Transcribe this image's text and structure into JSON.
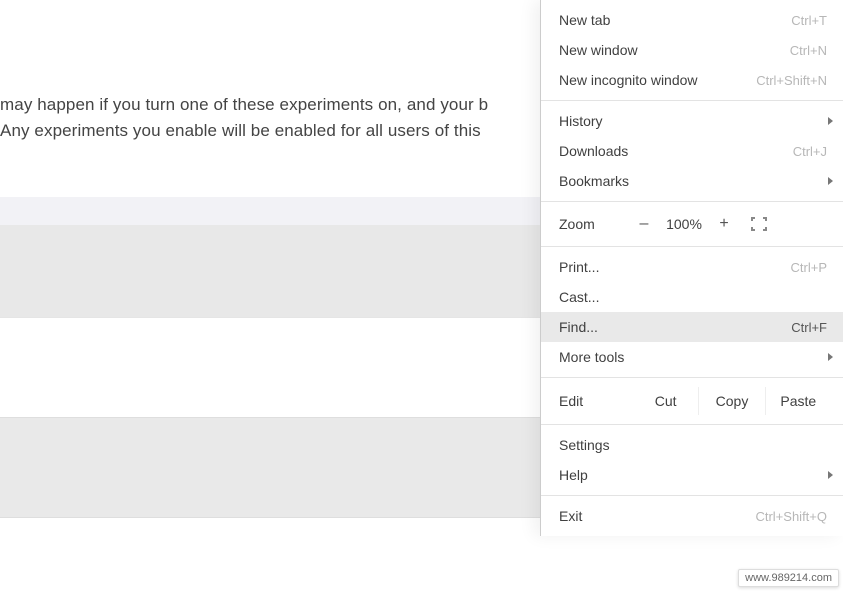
{
  "page": {
    "warning_line1": "may happen if you turn one of these experiments on, and your b",
    "warning_line2": "Any experiments you enable will be enabled for all users of this"
  },
  "menu": {
    "new_tab": {
      "label": "New tab",
      "shortcut": "Ctrl+T"
    },
    "new_window": {
      "label": "New window",
      "shortcut": "Ctrl+N"
    },
    "new_incognito": {
      "label": "New incognito window",
      "shortcut": "Ctrl+Shift+N"
    },
    "history": {
      "label": "History"
    },
    "downloads": {
      "label": "Downloads",
      "shortcut": "Ctrl+J"
    },
    "bookmarks": {
      "label": "Bookmarks"
    },
    "zoom": {
      "label": "Zoom",
      "minus": "–",
      "value": "100%",
      "plus": "+"
    },
    "print": {
      "label": "Print...",
      "shortcut": "Ctrl+P"
    },
    "cast": {
      "label": "Cast..."
    },
    "find": {
      "label": "Find...",
      "shortcut": "Ctrl+F"
    },
    "more_tools": {
      "label": "More tools"
    },
    "edit": {
      "label": "Edit",
      "cut": "Cut",
      "copy": "Copy",
      "paste": "Paste"
    },
    "settings": {
      "label": "Settings"
    },
    "help": {
      "label": "Help"
    },
    "exit": {
      "label": "Exit",
      "shortcut": "Ctrl+Shift+Q"
    }
  },
  "watermark": "www.989214.com"
}
